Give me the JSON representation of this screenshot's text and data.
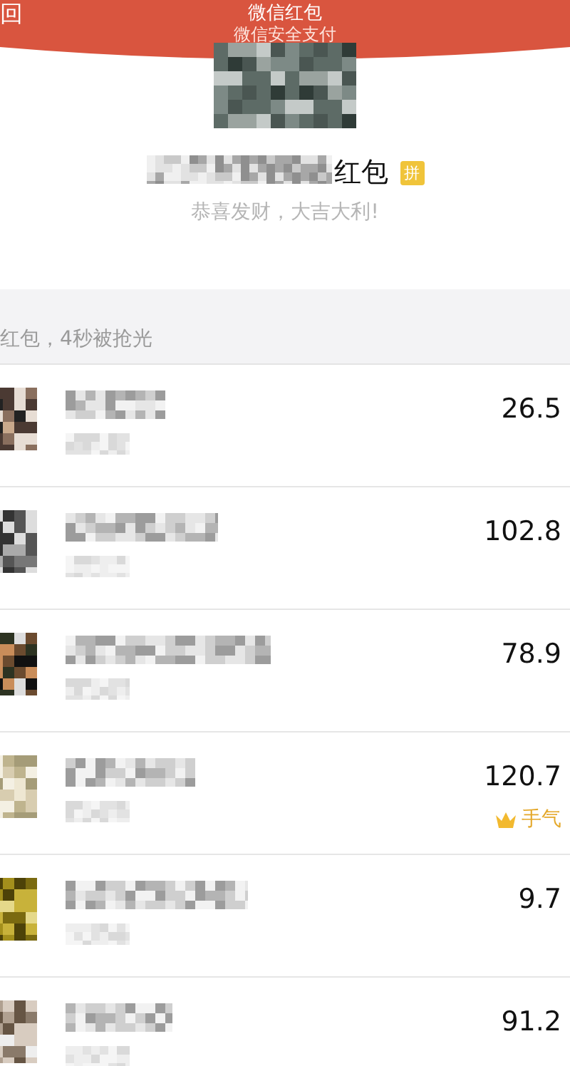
{
  "header": {
    "back": "回",
    "title": "微信红包",
    "subtitle": "微信安全支付"
  },
  "sender": {
    "name_suffix": "红包",
    "badge": "拼",
    "greeting": "恭喜发财，大吉大利!"
  },
  "summary": "红包，4秒被抢光",
  "records": [
    {
      "amount": "26.5",
      "best": false
    },
    {
      "amount": "102.8",
      "best": false
    },
    {
      "amount": "78.9",
      "best": false
    },
    {
      "amount": "120.7",
      "best": true,
      "best_label": "手气"
    },
    {
      "amount": "9.7",
      "best": false
    },
    {
      "amount": "91.2",
      "best": false
    }
  ]
}
